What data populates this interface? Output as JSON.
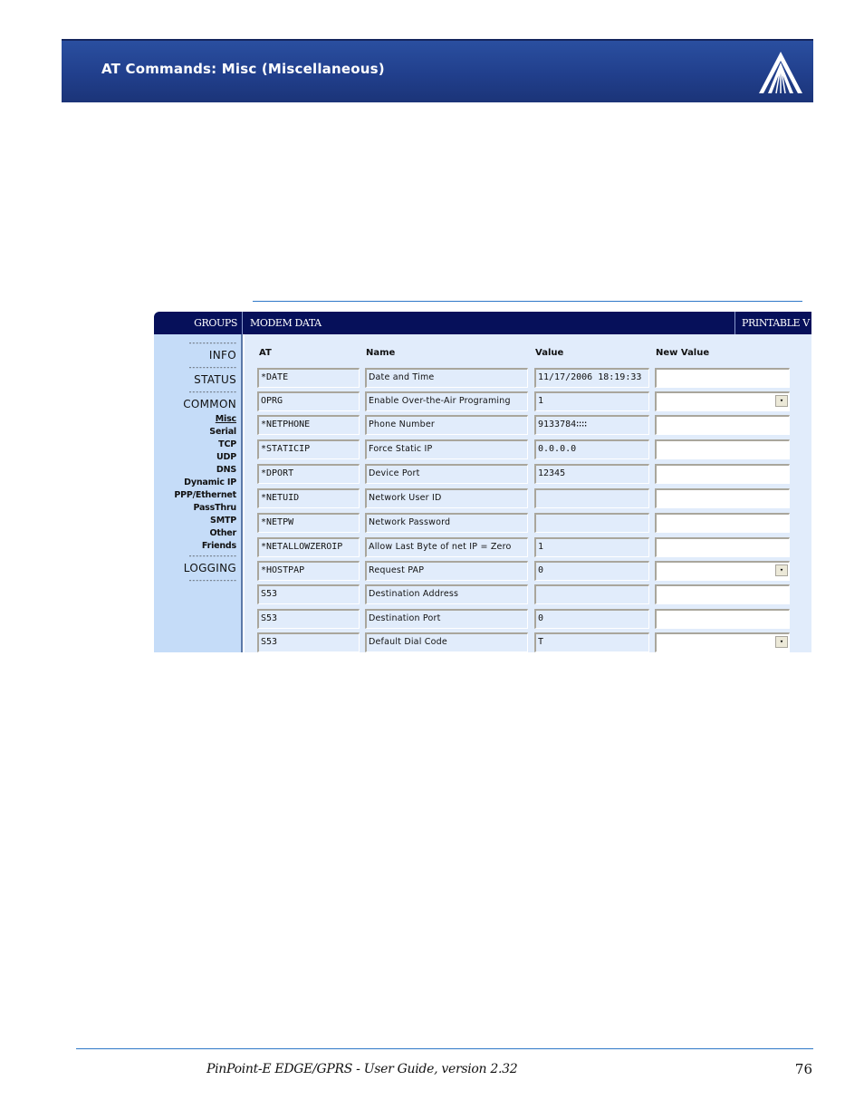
{
  "banner": {
    "title": "AT Commands: Misc (Miscellaneous)",
    "logo_icon": "triangle-rays-logo-icon"
  },
  "app": {
    "header": {
      "groups": "GROUPS",
      "modem_data": "MODEM DATA",
      "printable": "PRINTABLE V"
    },
    "sidebar": {
      "dash": "--------------",
      "groups": [
        {
          "label": "INFO",
          "items": []
        },
        {
          "label": "STATUS",
          "items": []
        },
        {
          "label": "COMMON",
          "items": [
            {
              "label": "Misc",
              "active": true
            },
            {
              "label": "Serial"
            },
            {
              "label": "TCP"
            },
            {
              "label": "UDP"
            },
            {
              "label": "DNS"
            },
            {
              "label": "Dynamic IP"
            },
            {
              "label": "PPP/Ethernet"
            },
            {
              "label": "PassThru"
            },
            {
              "label": "SMTP"
            },
            {
              "label": "Other"
            },
            {
              "label": "Friends"
            }
          ]
        },
        {
          "label": "LOGGING",
          "items": []
        }
      ]
    },
    "table": {
      "columns": [
        "AT",
        "Name",
        "Value",
        "New Value"
      ],
      "rows": [
        {
          "at": "*DATE",
          "name": "Date and Time",
          "value": "11/17/2006 18:19:33",
          "new_value": "",
          "new_type": "text"
        },
        {
          "at": "OPRG",
          "name": "Enable Over-the-Air Programing",
          "value": "1",
          "new_value": "",
          "new_type": "select"
        },
        {
          "at": "*NETPHONE",
          "name": "Phone Number",
          "value": "9133784∷∷",
          "new_value": "",
          "new_type": "text"
        },
        {
          "at": "*STATICIP",
          "name": "Force Static IP",
          "value": "0.0.0.0",
          "new_value": "",
          "new_type": "text"
        },
        {
          "at": "*DPORT",
          "name": "Device Port",
          "value": "12345",
          "new_value": "",
          "new_type": "text"
        },
        {
          "at": "*NETUID",
          "name": "Network User ID",
          "value": "",
          "new_value": "",
          "new_type": "text"
        },
        {
          "at": "*NETPW",
          "name": "Network Password",
          "value": "",
          "new_value": "",
          "new_type": "text"
        },
        {
          "at": "*NETALLOWZEROIP",
          "name": "Allow Last Byte of net IP = Zero",
          "value": "1",
          "new_value": "",
          "new_type": "text"
        },
        {
          "at": "*HOSTPAP",
          "name": "Request PAP",
          "value": "0",
          "new_value": "",
          "new_type": "select"
        },
        {
          "at": "S53",
          "name": "Destination Address",
          "value": "",
          "new_value": "",
          "new_type": "text"
        },
        {
          "at": "S53",
          "name": "Destination Port",
          "value": "0",
          "new_value": "",
          "new_type": "text"
        },
        {
          "at": "S53",
          "name": "Default Dial Code",
          "value": "T",
          "new_value": "",
          "new_type": "select"
        }
      ],
      "dropdown_glyph": "▾"
    }
  },
  "footer": {
    "text": "PinPoint-E EDGE/GPRS - User Guide, version 2.32",
    "page_number": "76"
  }
}
